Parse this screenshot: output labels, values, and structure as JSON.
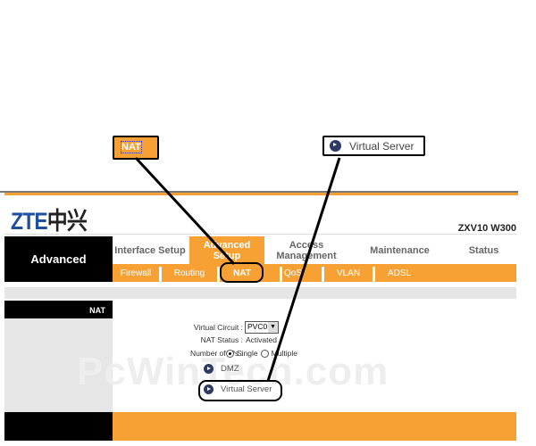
{
  "callouts": {
    "nat": "NAT",
    "virtual_server": "Virtual Server"
  },
  "header": {
    "logo": "ZTE中兴",
    "logo_latin": "ZTE",
    "logo_cn": "中兴",
    "model": "ZXV10 W300"
  },
  "nav": {
    "section": "Advanced",
    "tabs": [
      {
        "label": "Interface Setup"
      },
      {
        "label": "Advanced Setup",
        "active": true
      },
      {
        "label": "Access Management"
      },
      {
        "label": "Maintenance"
      },
      {
        "label": "Status"
      }
    ]
  },
  "subnav": [
    "Firewall",
    "Routing",
    "NAT",
    "QoS",
    "VLAN",
    "ADSL"
  ],
  "subnav_selected": "NAT",
  "sidebar": {
    "title": "NAT"
  },
  "form": {
    "virtual_circuit_label": "Virtual Circuit :",
    "virtual_circuit_value": "PVC0",
    "nat_status_label": "NAT Status :",
    "nat_status_value": "Activated",
    "num_ips_label": "Number of IPs :",
    "single": "Single",
    "multiple": "Multiple",
    "num_ips_selected": "Single"
  },
  "links": {
    "dmz": "DMZ",
    "virtual_server": "Virtual Server"
  },
  "watermark": "PcWinTech.com",
  "colors": {
    "accent": "#f7a033",
    "icon": "#2d3a63"
  }
}
